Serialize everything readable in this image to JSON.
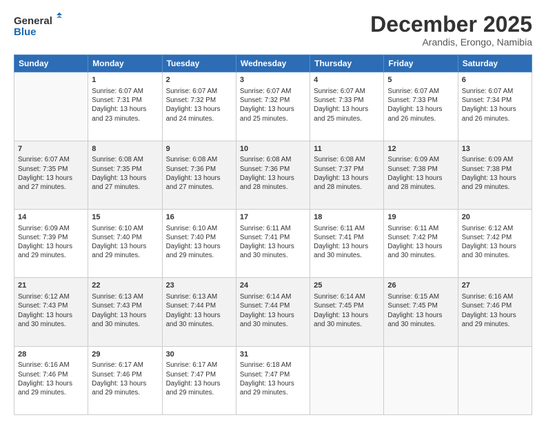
{
  "logo": {
    "line1": "General",
    "line2": "Blue"
  },
  "title": "December 2025",
  "subtitle": "Arandis, Erongo, Namibia",
  "header_days": [
    "Sunday",
    "Monday",
    "Tuesday",
    "Wednesday",
    "Thursday",
    "Friday",
    "Saturday"
  ],
  "weeks": [
    [
      {
        "day": "",
        "info": ""
      },
      {
        "day": "1",
        "info": "Sunrise: 6:07 AM\nSunset: 7:31 PM\nDaylight: 13 hours\nand 23 minutes."
      },
      {
        "day": "2",
        "info": "Sunrise: 6:07 AM\nSunset: 7:32 PM\nDaylight: 13 hours\nand 24 minutes."
      },
      {
        "day": "3",
        "info": "Sunrise: 6:07 AM\nSunset: 7:32 PM\nDaylight: 13 hours\nand 25 minutes."
      },
      {
        "day": "4",
        "info": "Sunrise: 6:07 AM\nSunset: 7:33 PM\nDaylight: 13 hours\nand 25 minutes."
      },
      {
        "day": "5",
        "info": "Sunrise: 6:07 AM\nSunset: 7:33 PM\nDaylight: 13 hours\nand 26 minutes."
      },
      {
        "day": "6",
        "info": "Sunrise: 6:07 AM\nSunset: 7:34 PM\nDaylight: 13 hours\nand 26 minutes."
      }
    ],
    [
      {
        "day": "7",
        "info": "Sunrise: 6:07 AM\nSunset: 7:35 PM\nDaylight: 13 hours\nand 27 minutes."
      },
      {
        "day": "8",
        "info": "Sunrise: 6:08 AM\nSunset: 7:35 PM\nDaylight: 13 hours\nand 27 minutes."
      },
      {
        "day": "9",
        "info": "Sunrise: 6:08 AM\nSunset: 7:36 PM\nDaylight: 13 hours\nand 27 minutes."
      },
      {
        "day": "10",
        "info": "Sunrise: 6:08 AM\nSunset: 7:36 PM\nDaylight: 13 hours\nand 28 minutes."
      },
      {
        "day": "11",
        "info": "Sunrise: 6:08 AM\nSunset: 7:37 PM\nDaylight: 13 hours\nand 28 minutes."
      },
      {
        "day": "12",
        "info": "Sunrise: 6:09 AM\nSunset: 7:38 PM\nDaylight: 13 hours\nand 28 minutes."
      },
      {
        "day": "13",
        "info": "Sunrise: 6:09 AM\nSunset: 7:38 PM\nDaylight: 13 hours\nand 29 minutes."
      }
    ],
    [
      {
        "day": "14",
        "info": "Sunrise: 6:09 AM\nSunset: 7:39 PM\nDaylight: 13 hours\nand 29 minutes."
      },
      {
        "day": "15",
        "info": "Sunrise: 6:10 AM\nSunset: 7:40 PM\nDaylight: 13 hours\nand 29 minutes."
      },
      {
        "day": "16",
        "info": "Sunrise: 6:10 AM\nSunset: 7:40 PM\nDaylight: 13 hours\nand 29 minutes."
      },
      {
        "day": "17",
        "info": "Sunrise: 6:11 AM\nSunset: 7:41 PM\nDaylight: 13 hours\nand 30 minutes."
      },
      {
        "day": "18",
        "info": "Sunrise: 6:11 AM\nSunset: 7:41 PM\nDaylight: 13 hours\nand 30 minutes."
      },
      {
        "day": "19",
        "info": "Sunrise: 6:11 AM\nSunset: 7:42 PM\nDaylight: 13 hours\nand 30 minutes."
      },
      {
        "day": "20",
        "info": "Sunrise: 6:12 AM\nSunset: 7:42 PM\nDaylight: 13 hours\nand 30 minutes."
      }
    ],
    [
      {
        "day": "21",
        "info": "Sunrise: 6:12 AM\nSunset: 7:43 PM\nDaylight: 13 hours\nand 30 minutes."
      },
      {
        "day": "22",
        "info": "Sunrise: 6:13 AM\nSunset: 7:43 PM\nDaylight: 13 hours\nand 30 minutes."
      },
      {
        "day": "23",
        "info": "Sunrise: 6:13 AM\nSunset: 7:44 PM\nDaylight: 13 hours\nand 30 minutes."
      },
      {
        "day": "24",
        "info": "Sunrise: 6:14 AM\nSunset: 7:44 PM\nDaylight: 13 hours\nand 30 minutes."
      },
      {
        "day": "25",
        "info": "Sunrise: 6:14 AM\nSunset: 7:45 PM\nDaylight: 13 hours\nand 30 minutes."
      },
      {
        "day": "26",
        "info": "Sunrise: 6:15 AM\nSunset: 7:45 PM\nDaylight: 13 hours\nand 30 minutes."
      },
      {
        "day": "27",
        "info": "Sunrise: 6:16 AM\nSunset: 7:46 PM\nDaylight: 13 hours\nand 29 minutes."
      }
    ],
    [
      {
        "day": "28",
        "info": "Sunrise: 6:16 AM\nSunset: 7:46 PM\nDaylight: 13 hours\nand 29 minutes."
      },
      {
        "day": "29",
        "info": "Sunrise: 6:17 AM\nSunset: 7:46 PM\nDaylight: 13 hours\nand 29 minutes."
      },
      {
        "day": "30",
        "info": "Sunrise: 6:17 AM\nSunset: 7:47 PM\nDaylight: 13 hours\nand 29 minutes."
      },
      {
        "day": "31",
        "info": "Sunrise: 6:18 AM\nSunset: 7:47 PM\nDaylight: 13 hours\nand 29 minutes."
      },
      {
        "day": "",
        "info": ""
      },
      {
        "day": "",
        "info": ""
      },
      {
        "day": "",
        "info": ""
      }
    ]
  ]
}
